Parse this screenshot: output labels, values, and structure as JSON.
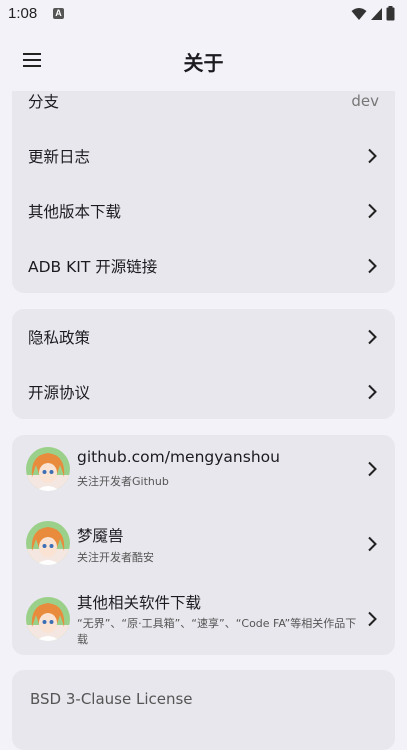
{
  "status_bar": {
    "time": "1:08",
    "notification_icon": "A"
  },
  "app_bar": {
    "title": "关于",
    "menu_icon": "hamburger-menu-icon"
  },
  "card_info": {
    "rows": [
      {
        "label": "分支",
        "value": "dev"
      },
      {
        "label": "更新日志"
      },
      {
        "label": "其他版本下载"
      },
      {
        "label": "ADB KIT 开源链接"
      }
    ]
  },
  "card_policy": {
    "rows": [
      {
        "label": "隐私政策"
      },
      {
        "label": "开源协议"
      }
    ]
  },
  "card_people": {
    "rows": [
      {
        "title": "github.com/mengyanshou",
        "subtitle": "关注开发者Github"
      },
      {
        "title": "梦魇兽",
        "subtitle": "关注开发者酷安"
      },
      {
        "title": "其他相关软件下载",
        "subtitle": "“无界”、“原·工具箱”、“速享”、“Code FA”等相关作品下载"
      }
    ]
  },
  "license": {
    "title": "BSD 3-Clause License"
  }
}
